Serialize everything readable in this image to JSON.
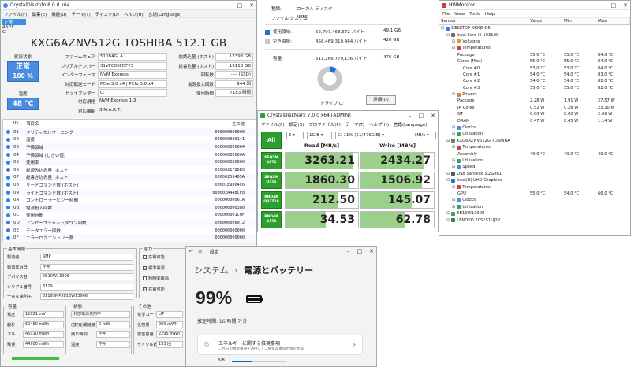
{
  "cdi": {
    "title": "CrystalDiskInfo 8.0.0 x64",
    "menu": [
      "ファイル(F)",
      "編集(E)",
      "機能(U)",
      "テーマ(T)",
      "ディスク(D)",
      "ヘルプ(H)",
      "言語(Language)"
    ],
    "drive_status": "正常",
    "drive_temp": "48 °C",
    "drive_letter": "C:",
    "model": "KXG6AZNV512G TOSHIBA 512.1 GB",
    "health_label": "健康状態",
    "health_status": "正常",
    "health_pct": "100 %",
    "temp_label": "温度",
    "temp_value": "48 °C",
    "left_fields": [
      {
        "label": "ファームウェア",
        "value": "5108AGLA"
      },
      {
        "label": "シリアルナンバー",
        "value": "31VFC00FDFP3"
      },
      {
        "label": "インターフェース",
        "value": "NVM Express"
      },
      {
        "label": "対応転送モード",
        "value": "PCIe 3.0 x4 | PCIe 3.0 x4"
      },
      {
        "label": "ドライブレター",
        "value": "C:"
      }
    ],
    "right_fields": [
      {
        "label": "総読込量 (ホスト)",
        "value": "17393 GB"
      },
      {
        "label": "総書込量 (ホスト)",
        "value": "19113 GB"
      },
      {
        "label": "回転数",
        "value": "---- (SSD)"
      },
      {
        "label": "電源投入回数",
        "value": "944 回"
      },
      {
        "label": "使用時間",
        "value": "7183 時間"
      }
    ],
    "standard_label": "対応規格",
    "standard_value": "NVM Express 1.3",
    "features_label": "対応機能",
    "features_value": "S.M.A.R.T.",
    "smart_headers": {
      "id": "ID",
      "name": "項目名",
      "raw": "生の値"
    },
    "smart_rows": [
      {
        "id": "01",
        "name": "クリティカルワーニング",
        "raw": "000000000000"
      },
      {
        "id": "02",
        "name": "温度",
        "raw": "000000000141"
      },
      {
        "id": "03",
        "name": "予備領域",
        "raw": "000000000064"
      },
      {
        "id": "04",
        "name": "予備領域 (しきい値)",
        "raw": "00000000000A"
      },
      {
        "id": "05",
        "name": "使用率",
        "raw": "000000000000"
      },
      {
        "id": "06",
        "name": "総読み込み量 (ホスト)",
        "raw": "0000021F8DB3"
      },
      {
        "id": "07",
        "name": "総書き込み量 (ホスト)",
        "raw": "00000255405A"
      },
      {
        "id": "08",
        "name": "リードコマンド数 (ホスト)",
        "raw": "00001E9804C6"
      },
      {
        "id": "09",
        "name": "ライトコマンド数 (ホスト)",
        "raw": "000002A448CF8"
      },
      {
        "id": "0A",
        "name": "コントローラービジー時間",
        "raw": "00000000061A"
      },
      {
        "id": "0B",
        "name": "電源投入回数",
        "raw": "000000000380"
      },
      {
        "id": "0C",
        "name": "使用時間",
        "raw": "000000001C0F"
      },
      {
        "id": "0D",
        "name": "アンセーフシャットダウン回数",
        "raw": "000000000072"
      },
      {
        "id": "0E",
        "name": "データエラー回数",
        "raw": "000000000000"
      },
      {
        "id": "0F",
        "name": "エラーログエントリー数",
        "raw": "000000000000"
      }
    ],
    "basic": {
      "title": "基本情報",
      "rows": [
        {
          "label": "製造者",
          "value": "SMP"
        },
        {
          "label": "製造年月日",
          "value": "不明"
        },
        {
          "label": "デバイス名",
          "value": "5B10W13906"
        },
        {
          "label": "シリアル番号",
          "value": "3119"
        },
        {
          "label": "一意な識別子",
          "value": "3119SMP5B10W13906"
        }
      ]
    },
    "ability": {
      "title": "能力",
      "items": [
        {
          "label": "充電可能",
          "checked": false
        },
        {
          "label": "標準電源",
          "checked": true
        },
        {
          "label": "短時間電源",
          "checked": false
        },
        {
          "label": "充電可能",
          "checked": true
        }
      ]
    },
    "capacity": {
      "title": "容量",
      "rows": [
        {
          "label": "電圧",
          "value": "12821 mV"
        },
        {
          "label": "設計",
          "value": "50450 mWh"
        },
        {
          "label": "フル",
          "value": "45910 mWh"
        },
        {
          "label": "残量",
          "value": "44900 mWh"
        }
      ]
    },
    "state": {
      "title": "状態",
      "rows": [
        {
          "label": "",
          "value": "外部電源使用中"
        },
        {
          "label": "(放/充)電速度",
          "value": "0 mW"
        },
        {
          "label": "残り時間",
          "value": "不明"
        },
        {
          "label": "温度",
          "value": "不明"
        }
      ]
    },
    "other": {
      "title": "その他",
      "rows": [
        {
          "label": "化学コード",
          "value": "LIP"
        },
        {
          "label": "低容量",
          "value": "200 mWh"
        },
        {
          "label": "警告容量",
          "value": "2295 mWh"
        },
        {
          "label": "サイクル数",
          "value": "133 回"
        }
      ]
    }
  },
  "prop": {
    "type_label": "種類:",
    "type_value": "ローカル ディスク",
    "fs_label": "ファイル システム:",
    "fs_value": "NTFS",
    "used_label": "使用領域:",
    "used_bytes": "52,797,468,672 バイト",
    "used_gb": "49.1 GB",
    "free_label": "空き領域:",
    "free_bytes": "458,469,310,464 バイト",
    "free_gb": "426 GB",
    "cap_label": "容量:",
    "cap_bytes": "511,266,779,136 バイト",
    "cap_gb": "476 GB",
    "drive_label": "ドライブ C:",
    "details_button": "詳細(D)",
    "used_fraction": 0.096,
    "used_color": "#1a73d9",
    "free_color": "#c8c8c8"
  },
  "cdm": {
    "title": "CrystalDiskMark 7.0.0 x64 [ADMIN]",
    "menu": [
      "ファイル(F)",
      "設定(S)",
      "プロファイル(P)",
      "テーマ(T)",
      "ヘルプ(H)",
      "言語(Language)"
    ],
    "all_label": "All",
    "count": "5",
    "size": "1GiB",
    "drive": "C: 11% (51/476GiB)",
    "unit": "MB/s",
    "read_header": "Read [MB/s]",
    "write_header": "Write [MB/s]",
    "tests": [
      {
        "line1": "SEQ1M",
        "line2": "Q8T1",
        "read": "3263.21",
        "write": "2434.27",
        "read_frac": 0.92,
        "write_frac": 0.86
      },
      {
        "line1": "SEQ1M",
        "line2": "Q1T1",
        "read": "1860.30",
        "write": "1506.92",
        "read_frac": 0.88,
        "write_frac": 0.84
      },
      {
        "line1": "RND4K",
        "line2": "Q32T16",
        "read": "212.50",
        "write": "145.07",
        "read_frac": 0.72,
        "write_frac": 0.7
      },
      {
        "line1": "RND4K",
        "line2": "Q1T1",
        "read": "34.53",
        "write": "62.78",
        "read_frac": 0.55,
        "write_frac": 0.6
      }
    ]
  },
  "hwm": {
    "title": "HWMonitor",
    "menu": [
      "File",
      "View",
      "Tools",
      "Help"
    ],
    "headers": {
      "sensor": "Sensor",
      "value": "Value",
      "min": "Min",
      "max": "Max"
    },
    "rows": [
      {
        "indent": 0,
        "name": "DESKTOP-NKKJMD5",
        "icon": "computer-icon",
        "value": "",
        "min": "",
        "max": ""
      },
      {
        "indent": 1,
        "name": "Intel Core i5 10310U",
        "icon": "cpu-icon",
        "value": "",
        "min": "",
        "max": ""
      },
      {
        "indent": 2,
        "name": "Voltages",
        "icon": "voltage-icon",
        "value": "",
        "min": "",
        "max": ""
      },
      {
        "indent": 2,
        "name": "Temperatures",
        "icon": "thermometer-icon",
        "value": "",
        "min": "",
        "max": ""
      },
      {
        "indent": 3,
        "name": "Package",
        "icon": "",
        "value": "55.0 °C",
        "min": "55.0 °C",
        "max": "84.0 °C"
      },
      {
        "indent": 3,
        "name": "Cores (Max)",
        "icon": "",
        "value": "55.0 °C",
        "min": "55.0 °C",
        "max": "84.0 °C"
      },
      {
        "indent": 4,
        "name": "Core #0",
        "icon": "",
        "value": "53.0 °C",
        "min": "53.0 °C",
        "max": "84.0 °C"
      },
      {
        "indent": 4,
        "name": "Core #1",
        "icon": "",
        "value": "54.0 °C",
        "min": "54.0 °C",
        "max": "83.0 °C"
      },
      {
        "indent": 4,
        "name": "Core #2",
        "icon": "",
        "value": "54.0 °C",
        "min": "54.0 °C",
        "max": "82.0 °C"
      },
      {
        "indent": 4,
        "name": "Core #3",
        "icon": "",
        "value": "55.0 °C",
        "min": "55.0 °C",
        "max": "82.0 °C"
      },
      {
        "indent": 2,
        "name": "Powers",
        "icon": "power-icon",
        "value": "",
        "min": "",
        "max": ""
      },
      {
        "indent": 3,
        "name": "Package",
        "icon": "",
        "value": "2.28 W",
        "min": "1.91 W",
        "max": "27.57 W"
      },
      {
        "indent": 3,
        "name": "IA Cores",
        "icon": "",
        "value": "0.52 W",
        "min": "0.28 W",
        "max": "23.30 W"
      },
      {
        "indent": 3,
        "name": "GT",
        "icon": "",
        "value": "0.00 W",
        "min": "0.00 W",
        "max": "2.66 W"
      },
      {
        "indent": 3,
        "name": "DRAM",
        "icon": "",
        "value": "0.47 W",
        "min": "0.45 W",
        "max": "1.14 W"
      },
      {
        "indent": 2,
        "name": "Clocks",
        "icon": "clock-icon",
        "value": "",
        "min": "",
        "max": ""
      },
      {
        "indent": 2,
        "name": "Utilization",
        "icon": "utilization-icon",
        "value": "",
        "min": "",
        "max": ""
      },
      {
        "indent": 1,
        "name": "KXG6AZNV512G TOSHIBA",
        "icon": "disk-icon",
        "value": "",
        "min": "",
        "max": ""
      },
      {
        "indent": 2,
        "name": "Temperatures",
        "icon": "thermometer-icon",
        "value": "",
        "min": "",
        "max": ""
      },
      {
        "indent": 3,
        "name": "Assembly",
        "icon": "",
        "value": "49.0 °C",
        "min": "49.0 °C",
        "max": "49.0 °C"
      },
      {
        "indent": 2,
        "name": "Utilization",
        "icon": "utilization-icon",
        "value": "",
        "min": "",
        "max": ""
      },
      {
        "indent": 2,
        "name": "Speed",
        "icon": "speed-icon",
        "value": "",
        "min": "",
        "max": ""
      },
      {
        "indent": 1,
        "name": "USB  SanDisk 3.2Gen1",
        "icon": "usb-icon",
        "value": "",
        "min": "",
        "max": ""
      },
      {
        "indent": 1,
        "name": "Intel(R) UHD Graphics",
        "icon": "gpu-icon",
        "value": "",
        "min": "",
        "max": ""
      },
      {
        "indent": 2,
        "name": "Temperatures",
        "icon": "thermometer-icon",
        "value": "",
        "min": "",
        "max": ""
      },
      {
        "indent": 3,
        "name": "GPU",
        "icon": "",
        "value": "55.0 °C",
        "min": "54.0 °C",
        "max": "66.0 °C"
      },
      {
        "indent": 2,
        "name": "Clocks",
        "icon": "clock-icon",
        "value": "",
        "min": "",
        "max": ""
      },
      {
        "indent": 2,
        "name": "Utilization",
        "icon": "utilization-icon",
        "value": "",
        "min": "",
        "max": ""
      },
      {
        "indent": 1,
        "name": "5B10W13906",
        "icon": "battery-icon",
        "value": "",
        "min": "",
        "max": ""
      },
      {
        "indent": 1,
        "name": "LENOVO 20S1S1UJ2P",
        "icon": "board-icon",
        "value": "",
        "min": "",
        "max": ""
      }
    ]
  },
  "settings": {
    "title": "設定",
    "crumb_parent": "システム",
    "crumb_sep": "›",
    "crumb_current": "電源とバッテリー",
    "battery_pct": "99%",
    "battery_level": 0.99,
    "full_charge_label": "推定時間: 16 時間 7 分",
    "eco_title": "エネルギーに関する推奨事項",
    "eco_sub": "これらの推奨事項を適用して二酸化炭素排出量を削減",
    "eco_progress": "3/8",
    "eco_fraction": 0.375
  }
}
